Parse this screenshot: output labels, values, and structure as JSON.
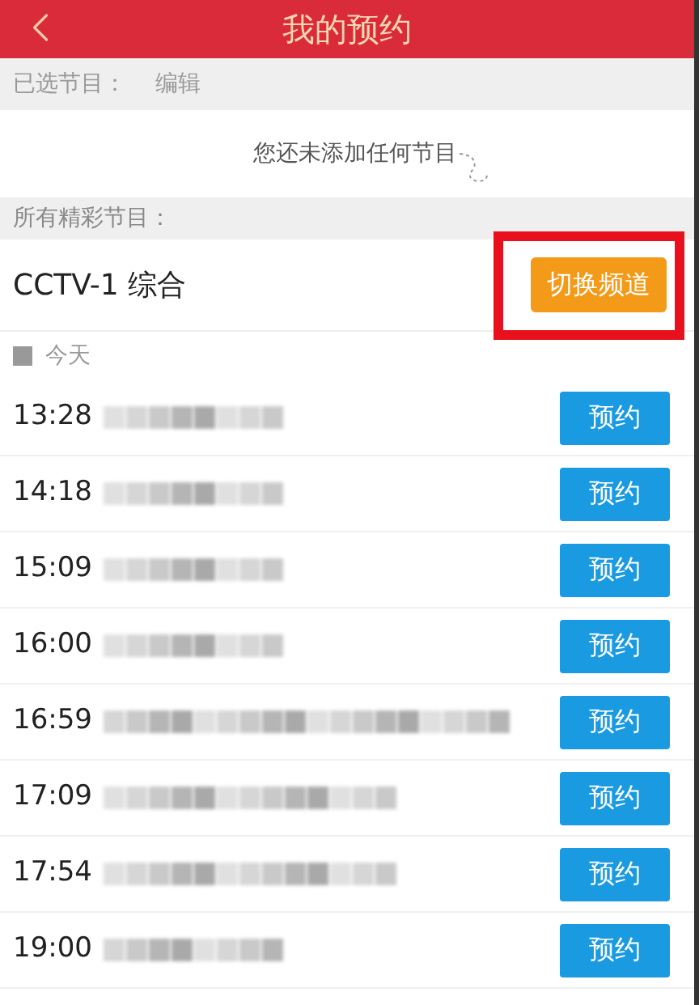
{
  "header": {
    "title": "我的预约"
  },
  "selected_section": {
    "label": "已选节目：",
    "action": "编辑",
    "empty_message": "您还未添加任何节目"
  },
  "all_section": {
    "label": "所有精彩节目："
  },
  "channel": {
    "name": "CCTV-1 综合",
    "switch_button": "切换频道",
    "highlighted": true
  },
  "day": {
    "label": "今天"
  },
  "programs": [
    {
      "time": "13:28",
      "button": "预约"
    },
    {
      "time": "14:18",
      "button": "预约"
    },
    {
      "time": "15:09",
      "button": "预约"
    },
    {
      "time": "16:00",
      "button": "预约"
    },
    {
      "time": "16:59",
      "button": "预约"
    },
    {
      "time": "17:09",
      "button": "预约"
    },
    {
      "time": "17:54",
      "button": "预约"
    },
    {
      "time": "19:00",
      "button": "预约"
    }
  ]
}
